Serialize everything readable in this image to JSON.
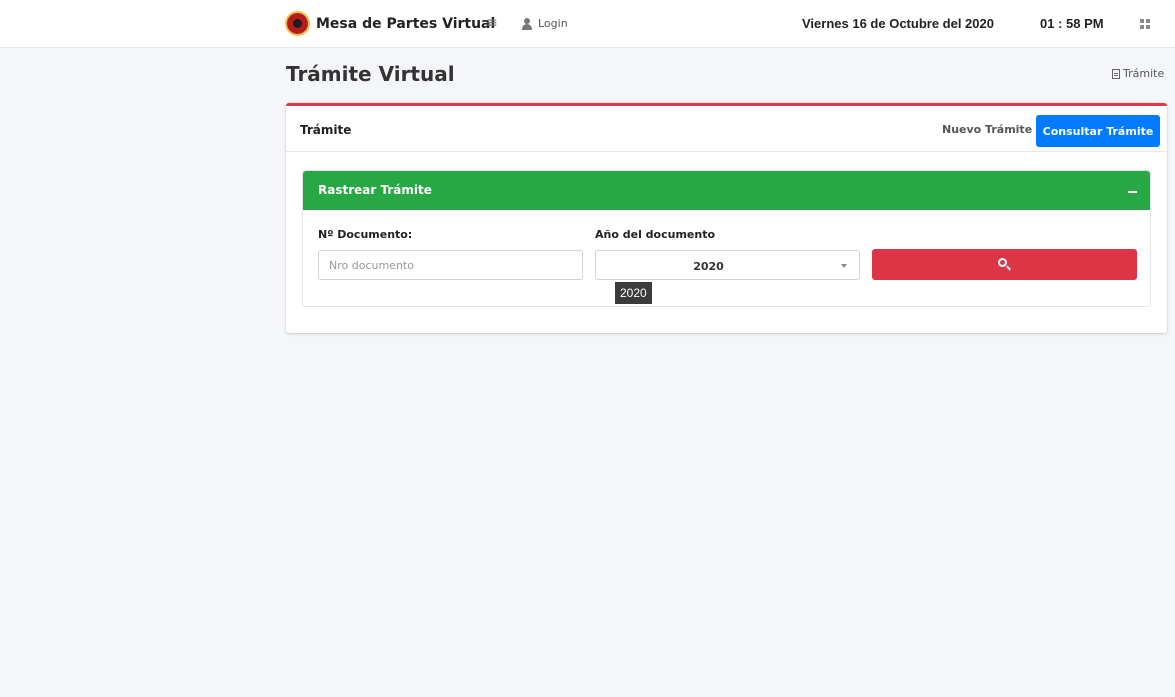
{
  "header": {
    "brand": "Mesa de Partes Virtual",
    "login_label": "Login",
    "date": "Viernes 16 de Octubre del 2020",
    "time": "01 : 58 PM"
  },
  "page": {
    "title": "Trámite Virtual",
    "breadcrumb": "Trámite"
  },
  "card": {
    "title": "Trámite",
    "nuevo_label": "Nuevo Trámite",
    "consultar_label": "Consultar Trámite"
  },
  "search_panel": {
    "title": "Rastrear Trámite",
    "doc_label": "Nº Documento:",
    "doc_placeholder": "Nro documento",
    "year_label": "Año del documento",
    "year_value": "2020",
    "tooltip": "2020"
  },
  "colors": {
    "primary": "#007bff",
    "success": "#28a745",
    "danger": "#dc3545"
  }
}
